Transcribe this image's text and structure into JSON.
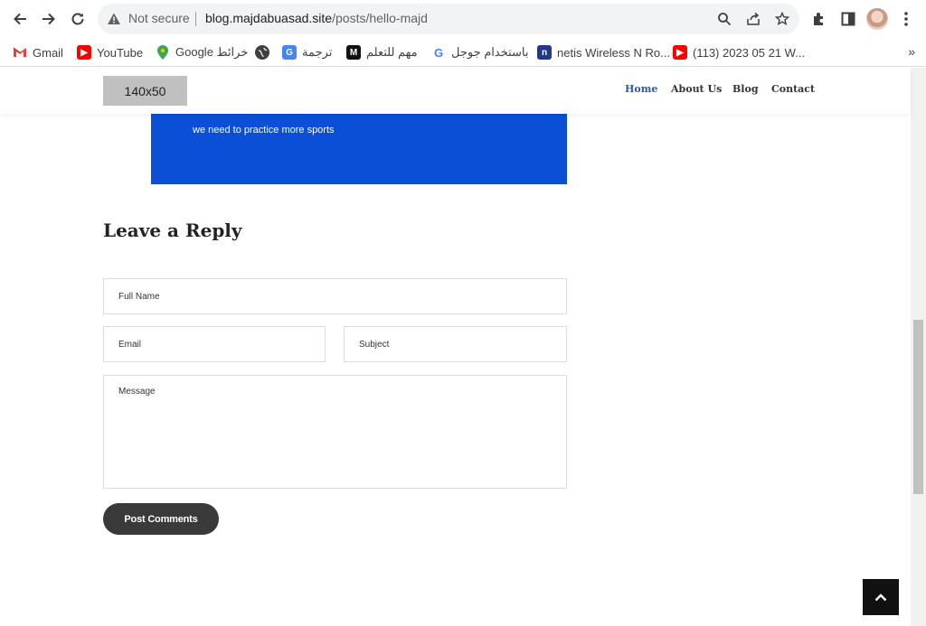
{
  "browser": {
    "security_label": "Not secure",
    "url_host": "blog.majdabuasad.site",
    "url_path": "/posts/hello-majd"
  },
  "bookmarks": [
    {
      "label": "Gmail",
      "icon": "gmail-icon"
    },
    {
      "label": "YouTube",
      "icon": "youtube-icon"
    },
    {
      "label": "Google خرائط",
      "icon": "maps-icon"
    },
    {
      "label": "",
      "icon": "globe-icon"
    },
    {
      "label": "ترجمة",
      "icon": "translate-icon"
    },
    {
      "label": "مهم للتعلم",
      "icon": "bookmark-m-icon"
    },
    {
      "label": "باستخدام جوجل",
      "icon": "google-icon"
    },
    {
      "label": "netis Wireless N Ro...",
      "icon": "netis-icon"
    },
    {
      "label": "(113) 2023 05 21 W...",
      "icon": "youtube-icon"
    }
  ],
  "bookmarks_more": "»",
  "site": {
    "logo": "140x50",
    "nav": [
      "Home",
      "About Us",
      "Blog",
      "Contact"
    ],
    "active_nav": "Home"
  },
  "post": {
    "blue_text": "we need to practice more sports"
  },
  "reply": {
    "title": "Leave a Reply",
    "full_name_placeholder": "Full Name",
    "email_placeholder": "Email",
    "subject_placeholder": "Subject",
    "message_placeholder": "Message",
    "submit_label": "Post Comments"
  },
  "colors": {
    "accent_nav": "#2b5aa8",
    "blue_box": "#0a4fd6",
    "button": "#3a3a3a"
  }
}
